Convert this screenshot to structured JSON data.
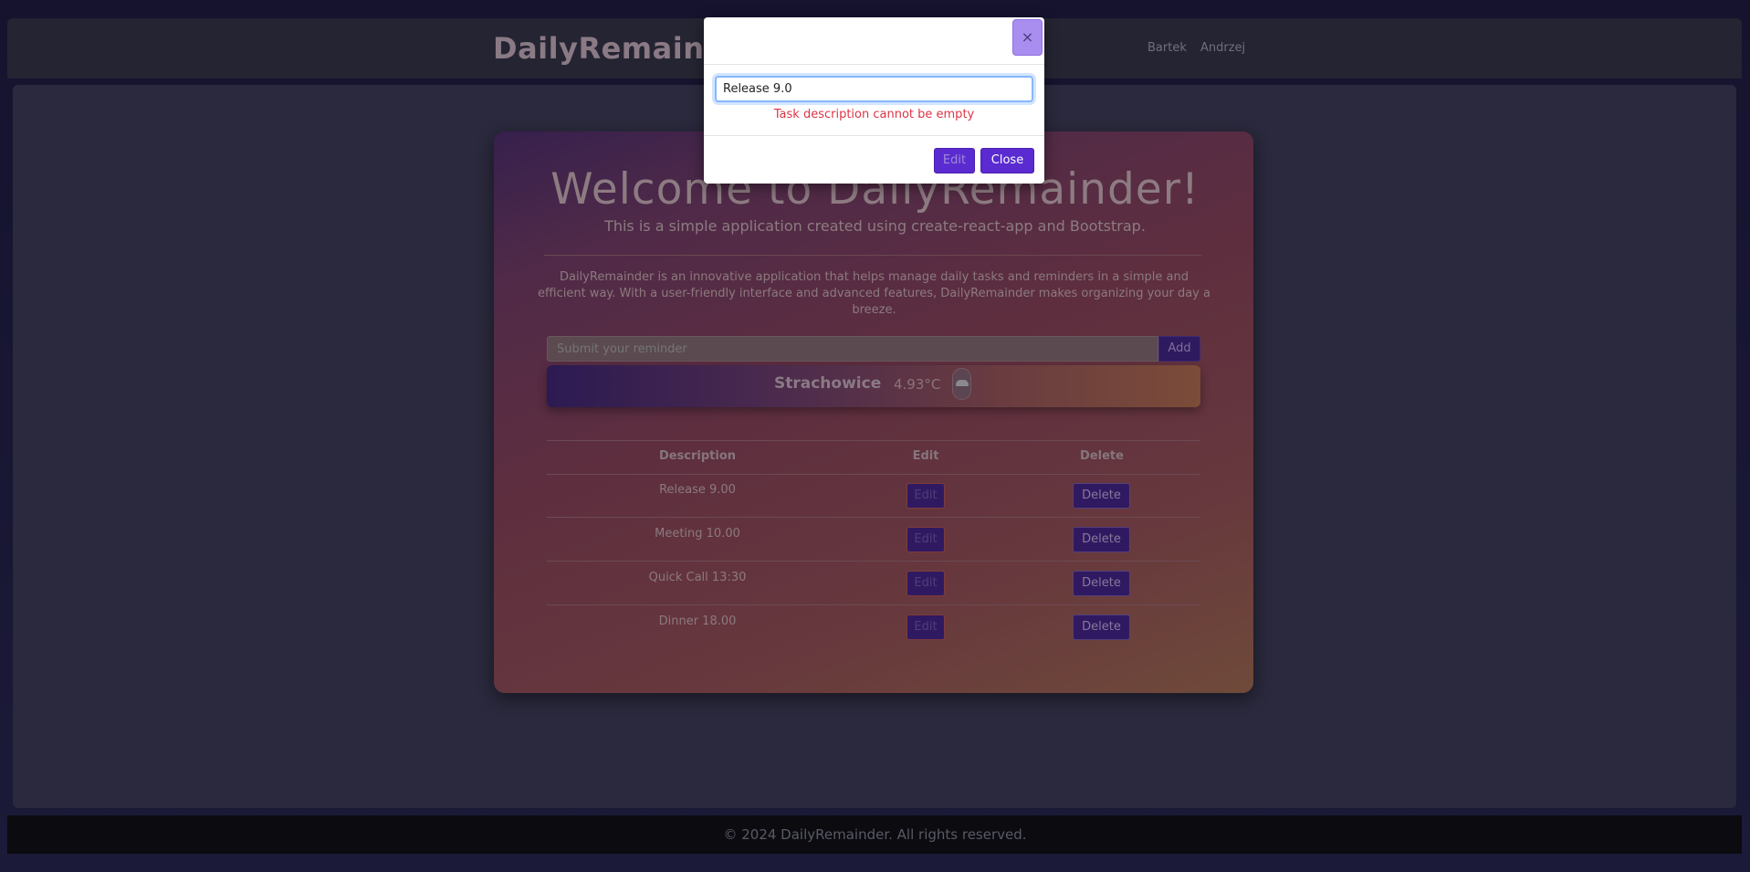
{
  "navbar": {
    "brand": "DailyRemainder",
    "links": [
      "Bartek",
      "Andrzej"
    ]
  },
  "hero": {
    "title": "Welcome to DailyRemainder!",
    "subtitle": "This is a simple application created using create-react-app and Bootstrap.",
    "intro": "DailyRemainder is an innovative application that helps manage daily tasks and reminders in a simple and efficient way. With a user-friendly interface and advanced features, DailyRemainder makes organizing your day a breeze."
  },
  "add_form": {
    "placeholder": "Submit your reminder",
    "add_label": "Add"
  },
  "weather": {
    "city": "Strachowice",
    "temperature": "4.93°C",
    "icon": "cloud-icon"
  },
  "table": {
    "headers": [
      "Description",
      "Edit",
      "Delete"
    ],
    "rows": [
      {
        "description": "Release 9.00",
        "edit": "Edit",
        "delete": "Delete"
      },
      {
        "description": "Meeting 10.00",
        "edit": "Edit",
        "delete": "Delete"
      },
      {
        "description": "Quick Call 13:30",
        "edit": "Edit",
        "delete": "Delete"
      },
      {
        "description": "Dinner 18.00",
        "edit": "Edit",
        "delete": "Delete"
      }
    ]
  },
  "footer": {
    "text": "© 2024 DailyRemainder. All rights reserved."
  },
  "modal": {
    "close_x": "×",
    "input_value": "Release 9.0",
    "error": "Task description cannot be empty",
    "edit_label": "Edit",
    "close_label": "Close"
  },
  "colors": {
    "accent": "#5a2bd0",
    "error": "#dc3545",
    "focus_ring": "#86b7fe"
  }
}
